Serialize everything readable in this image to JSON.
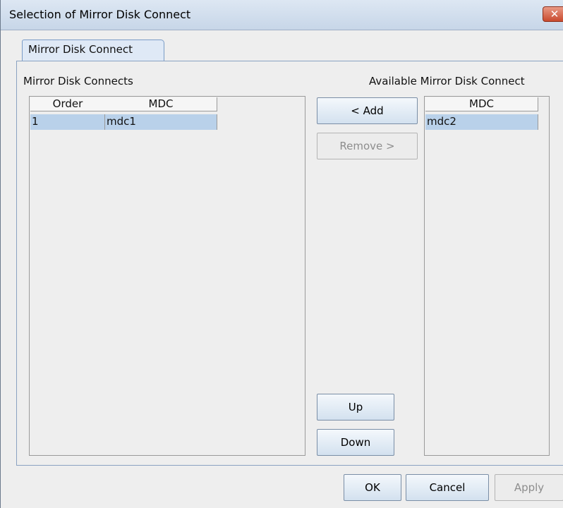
{
  "window": {
    "title": "Selection of Mirror Disk Connect",
    "close_glyph": "✕"
  },
  "tab": {
    "label": "Mirror Disk Connect"
  },
  "left_list": {
    "label": "Mirror Disk Connects",
    "columns": [
      "Order",
      "MDC"
    ],
    "rows": [
      {
        "order": "1",
        "mdc": "mdc1"
      }
    ]
  },
  "right_list": {
    "label": "Available Mirror Disk Connect",
    "columns": [
      "MDC"
    ],
    "rows": [
      {
        "mdc": "mdc2"
      }
    ]
  },
  "buttons": {
    "add": "< Add",
    "remove": "Remove >",
    "up": "Up",
    "down": "Down",
    "ok": "OK",
    "cancel": "Cancel",
    "apply": "Apply"
  },
  "colors": {
    "selection": "#b9d1ea",
    "close": "#c94a2e",
    "tab": "#dfe9f6"
  }
}
